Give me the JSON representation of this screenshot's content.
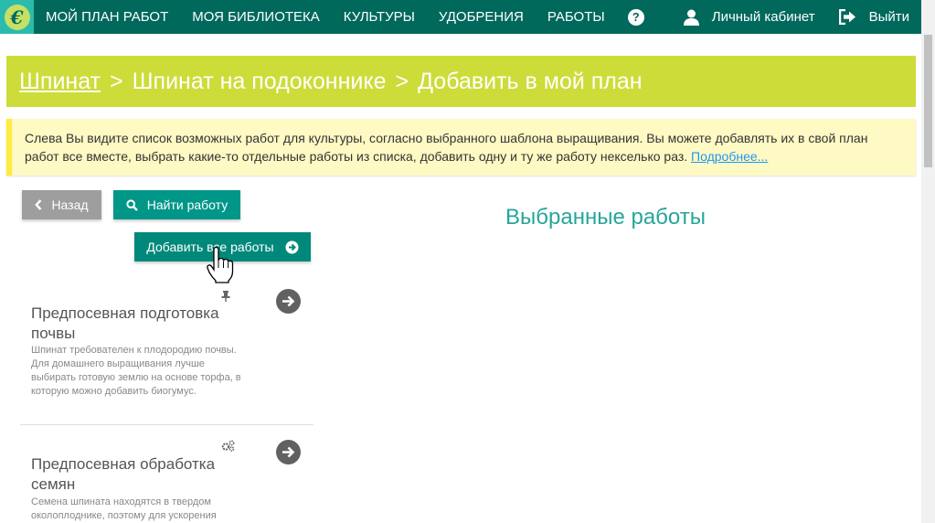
{
  "nav": {
    "logo_glyph": "€",
    "items": [
      "МОЙ ПЛАН РАБОТ",
      "МОЯ БИБЛИОТЕКА",
      "КУЛЬТУРЫ",
      "УДОБРЕНИЯ",
      "РАБОТЫ"
    ],
    "help_icon": "question-circle-icon",
    "help_glyph": "?",
    "account_label": "Личный кабинет",
    "logout_label": "Выйти"
  },
  "breadcrumb": {
    "crop": "Шпинат",
    "sep1": ">",
    "template": "Шпинат на подоконнике",
    "sep2": ">",
    "current": "Добавить в мой план"
  },
  "note": {
    "text": "Слева Вы видите список возможных работ для культуры, согласно выбранного шаблона выращивания. Вы можете добавлять их в свой план работ все вместе, выбрать какие-то отдельные работы из списка, добавить одну и ту же работу некселько раз.",
    "link": "Подробнее..."
  },
  "buttons": {
    "back": "Назад",
    "find": "Найти работу",
    "add_all": "Добавить все работы"
  },
  "selected_title": "Выбранные работы",
  "works": [
    {
      "title": "Предпосевная подготовка почвы",
      "description": "Шпинат требователен к плодородию почвы. Для домашнего выращивания лучше выбирать готовую землю на основе торфа, в которую можно добавить биогумус.",
      "icon": "pin-icon"
    },
    {
      "title": "Предпосевная обработка семян",
      "description": "Семена шпината находятся в твердом околоплоднике, поэтому для ускорения",
      "icon": "gears-icon"
    }
  ],
  "colors": {
    "navbar": "#00695c",
    "banner": "#cddc39",
    "note_bg": "#fff9c4",
    "teal_button": "#009688",
    "accent_text": "#26a69a"
  }
}
